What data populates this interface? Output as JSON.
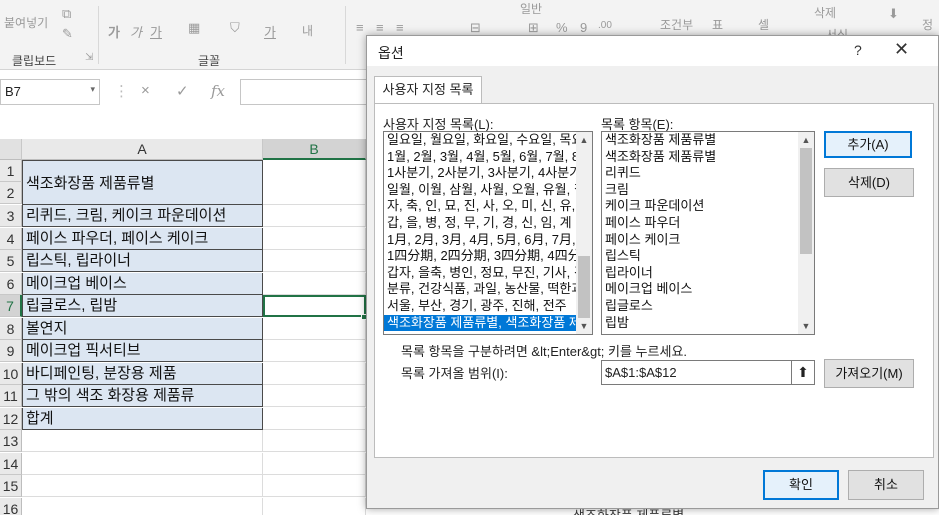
{
  "ribbon": {
    "paste_label": "붙여넣기",
    "font_chars": [
      "가",
      "가",
      "가"
    ],
    "ruby_label": "내",
    "table_label": "표",
    "format_label": "조건부",
    "cell_label": "셀",
    "delete_label": "삭제",
    "format_group_label": "서식",
    "sort_label": "정",
    "number_format": "일반",
    "groups": {
      "clipboard": "클립보드",
      "font": "글꼴"
    }
  },
  "formula_bar": {
    "name_box": "B7",
    "cancel_icon": "×",
    "enter_icon": "✓",
    "fx_icon": "fx",
    "value": ""
  },
  "sheet": {
    "columns": [
      "A",
      "B"
    ],
    "rows": [
      "1",
      "2",
      "3",
      "4",
      "5",
      "6",
      "7",
      "8",
      "9",
      "10",
      "11",
      "12",
      "13",
      "14",
      "15",
      "16"
    ],
    "cells": {
      "a1": "색조화장품 제품류별",
      "a3": "리퀴드, 크림, 케이크 파운데이션",
      "a4": "페이스 파우더, 페이스 케이크",
      "a5": "립스틱, 립라이너",
      "a6": "메이크업 베이스",
      "a7": "립글로스, 립밤",
      "a8": "볼연지",
      "a9": "메이크업 픽서티브",
      "a10": "바디페인팅, 분장용 제품",
      "a11": "그 밖의 색조 화장용 제품류",
      "a12": "합계"
    },
    "overflow_text": "색조화장품 제품류별"
  },
  "dialog": {
    "title": "옵션",
    "help": "?",
    "close": "✕",
    "tab": "사용자 지정 목록",
    "custom_lists_label": "사용자 지정 목록(L):",
    "custom_lists": [
      "일요일, 월요일, 화요일, 수요일, 목요일",
      "1월, 2월, 3월, 4월, 5월, 6월, 7월, 8월",
      "1사분기, 2사분기, 3사분기, 4사분기",
      "일월, 이월, 삼월, 사월, 오월, 유월, 칠",
      "자, 축, 인, 묘, 진, 사, 오, 미, 신, 유, 술",
      "갑, 을, 병, 정, 무, 기, 경, 신, 임, 계",
      "1月, 2月, 3月, 4月, 5月, 6月, 7月, 8月",
      "1四分期, 2四分期, 3四分期, 4四分期",
      "갑자, 을축, 병인, 정묘, 무진, 기사, 경오",
      "분류, 건강식품, 과일, 농산물, 떡한과",
      "서울, 부산, 경기, 광주, 진해, 전주",
      "색조화장품 제품류별, 색조화장품 제"
    ],
    "list_entries_label": "목록 항목(E):",
    "list_entries": [
      "색조화장품 제품류별",
      "색조화장품 제품류별",
      "리퀴드",
      "크림",
      "케이크 파운데이션",
      "페이스 파우더",
      "페이스 케이크",
      "립스틱",
      "립라이너",
      "메이크업 베이스",
      "립글로스",
      "립밤"
    ],
    "add_button": "추가(A)",
    "delete_button": "삭제(D)",
    "hint": "목록 항목을 구분하려면 &lt;Enter&gt; 키를 누르세요.",
    "import_label": "목록 가져올 범위(I):",
    "import_range": "$A$1:$A$12",
    "import_button": "가져오기(M)",
    "ok_button": "확인",
    "cancel_button": "취소"
  }
}
